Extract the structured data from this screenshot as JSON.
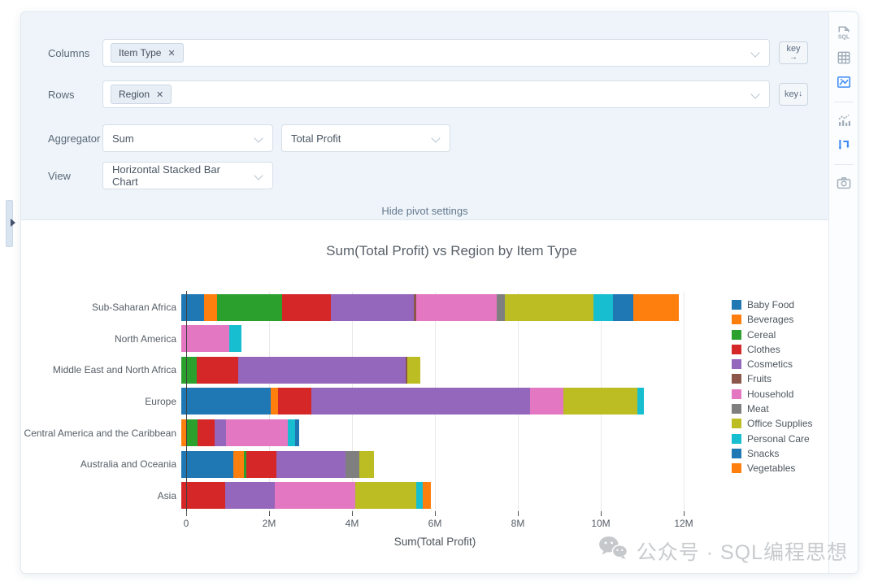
{
  "accent_color": "#3d8af7",
  "settings": {
    "columns": {
      "label": "Columns",
      "tags": [
        "Item Type"
      ],
      "remove_icon": "✕",
      "key_button": {
        "text": "key",
        "arrow": "→"
      }
    },
    "rows": {
      "label": "Rows",
      "tags": [
        "Region"
      ],
      "remove_icon": "✕",
      "key_button": {
        "text": "key",
        "arrow": "↓"
      }
    },
    "aggregator": {
      "label": "Aggregator",
      "selects": [
        "Sum",
        "Total Profit"
      ]
    },
    "view": {
      "label": "View",
      "selects": [
        "Horizontal Stacked Bar Chart"
      ]
    },
    "hide_link": "Hide pivot settings"
  },
  "sidebar": {
    "icons": [
      {
        "name": "sql-icon",
        "active": false,
        "divider_after": false
      },
      {
        "name": "table-grid-icon",
        "active": false,
        "divider_after": false
      },
      {
        "name": "image-chart-icon",
        "active": true,
        "divider_after": true
      },
      {
        "name": "combo-chart-icon",
        "active": false,
        "divider_after": false
      },
      {
        "name": "pivot-icon",
        "active": true,
        "divider_after": true
      },
      {
        "name": "camera-icon",
        "active": false,
        "divider_after": false
      }
    ]
  },
  "chart_data": {
    "type": "bar",
    "orientation": "horizontal",
    "stacked": true,
    "title": "Sum(Total Profit) vs Region by Item Type",
    "xlabel": "Sum(Total Profit)",
    "ylabel": "",
    "x_ticks": [
      "0",
      "2M",
      "4M",
      "6M",
      "8M",
      "10M",
      "12M"
    ],
    "x_max_millions": 12,
    "grid": true,
    "legend_position": "right",
    "categories": [
      "Sub-Saharan Africa",
      "North America",
      "Middle East and North Africa",
      "Europe",
      "Central America and the Caribbean",
      "Australia and Oceania",
      "Asia"
    ],
    "values_unit": "millions",
    "series": [
      {
        "name": "Baby Food",
        "color": "#1f77b4",
        "values": [
          0.55,
          0,
          0,
          2.15,
          0,
          1.25,
          0
        ]
      },
      {
        "name": "Beverages",
        "color": "#ff7f0e",
        "values": [
          0.33,
          0,
          0,
          0.18,
          0.14,
          0.26,
          0
        ]
      },
      {
        "name": "Cereal",
        "color": "#2ca02c",
        "values": [
          1.6,
          0,
          0.37,
          0,
          0.26,
          0.06,
          0
        ]
      },
      {
        "name": "Clothes",
        "color": "#d62728",
        "values": [
          1.18,
          0,
          1.0,
          0.8,
          0.4,
          0.73,
          1.06
        ]
      },
      {
        "name": "Cosmetics",
        "color": "#9467bd",
        "values": [
          2.04,
          0,
          4.05,
          5.28,
          0.27,
          1.67,
          1.2
        ]
      },
      {
        "name": "Fruits",
        "color": "#8c564b",
        "values": [
          0.06,
          0,
          0.04,
          0,
          0,
          0,
          0
        ]
      },
      {
        "name": "Household",
        "color": "#e377c2",
        "values": [
          1.98,
          1.16,
          0,
          0.8,
          1.49,
          0,
          1.94
        ]
      },
      {
        "name": "Meat",
        "color": "#7f7f7f",
        "values": [
          0.2,
          0,
          0,
          0,
          0,
          0.33,
          0
        ]
      },
      {
        "name": "Office Supplies",
        "color": "#bcbd22",
        "values": [
          2.16,
          0,
          0.3,
          1.79,
          0,
          0.35,
          1.47
        ]
      },
      {
        "name": "Personal Care",
        "color": "#17becf",
        "values": [
          0.49,
          0.3,
          0,
          0.15,
          0.18,
          0,
          0.16
        ]
      },
      {
        "name": "Snacks",
        "color": "#1f77b4",
        "values": [
          0.49,
          0,
          0,
          0,
          0.1,
          0,
          0
        ]
      },
      {
        "name": "Vegetables",
        "color": "#ff7f0e",
        "values": [
          1.12,
          0,
          0,
          0,
          0,
          0,
          0.2
        ]
      }
    ],
    "totals_millions": [
      12.2,
      1.46,
      5.76,
      11.15,
      2.84,
      4.65,
      6.03
    ]
  },
  "watermark": {
    "text": "公众号 · SQL编程思想",
    "icon": "wechat-icon"
  }
}
